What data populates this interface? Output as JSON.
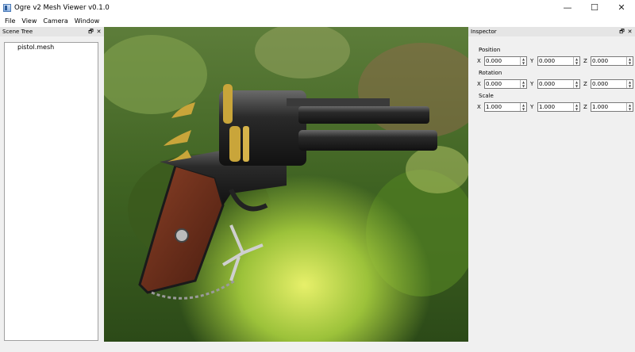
{
  "window": {
    "title": "Ogre v2 Mesh Viewer v0.1.0",
    "controls": {
      "minimize": "—",
      "maximize": "☐",
      "close": "✕"
    }
  },
  "menubar": {
    "items": [
      "File",
      "View",
      "Camera",
      "Window"
    ]
  },
  "scene_tree": {
    "title": "Scene Tree",
    "float_icon": "🗗",
    "close_icon": "✕",
    "items": [
      "pistol.mesh"
    ]
  },
  "viewport": {
    "content": "3D render of revolver mesh over a foliage background"
  },
  "inspector": {
    "title": "Inspector",
    "float_icon": "🗗",
    "close_icon": "✕",
    "position": {
      "label": "Position",
      "x": "0.000",
      "y": "0.000",
      "z": "0.000"
    },
    "rotation": {
      "label": "Rotation",
      "x": "0.000",
      "y": "0.000",
      "z": "0.000"
    },
    "scale": {
      "label": "Scale",
      "x": "1.000",
      "y": "1.000",
      "z": "1.000"
    },
    "axis_labels": {
      "x": "X",
      "y": "Y",
      "z": "Z"
    }
  },
  "colors": {
    "wood": "#6b2f1c",
    "metal": "#222222",
    "gold": "#c9a53a",
    "foliage": "#4f7a22"
  }
}
